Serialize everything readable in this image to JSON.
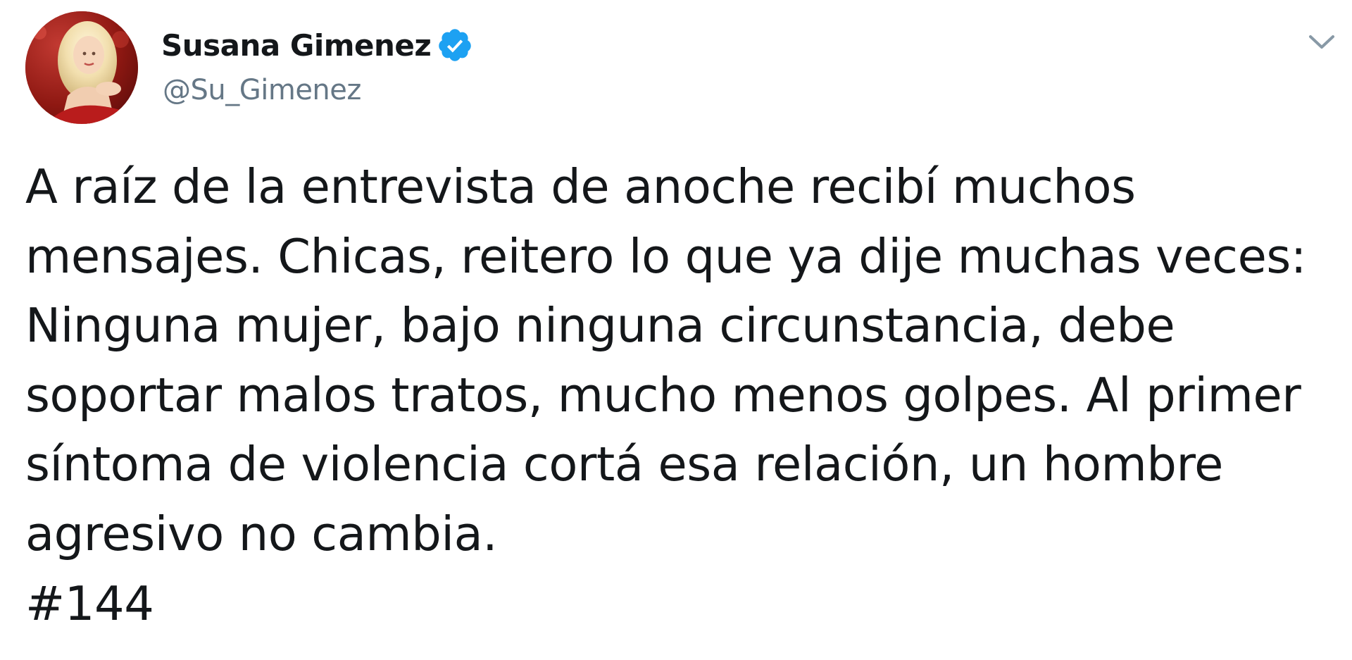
{
  "author": {
    "name": "Susana Gimenez",
    "handle": "@Su_Gimenez",
    "verified": true,
    "avatar_icon": "profile-photo",
    "verified_icon": "verified-badge-icon",
    "verified_color": "#1da1f2"
  },
  "menu": {
    "icon": "chevron-down-icon"
  },
  "tweet": {
    "lines": [
      "A raíz de la entrevista de anoche recibí muchos",
      "mensajes. Chicas, reitero lo que ya dije muchas veces:",
      "Ninguna mujer, bajo ninguna circunstancia, debe",
      "soportar malos tratos, mucho menos golpes. Al primer",
      "síntoma de violencia cortá esa relación, un hombre",
      "agresivo no cambia."
    ],
    "hashtag": "#144"
  },
  "colors": {
    "text": "#14171a",
    "secondary": "#657786",
    "background": "#ffffff"
  }
}
